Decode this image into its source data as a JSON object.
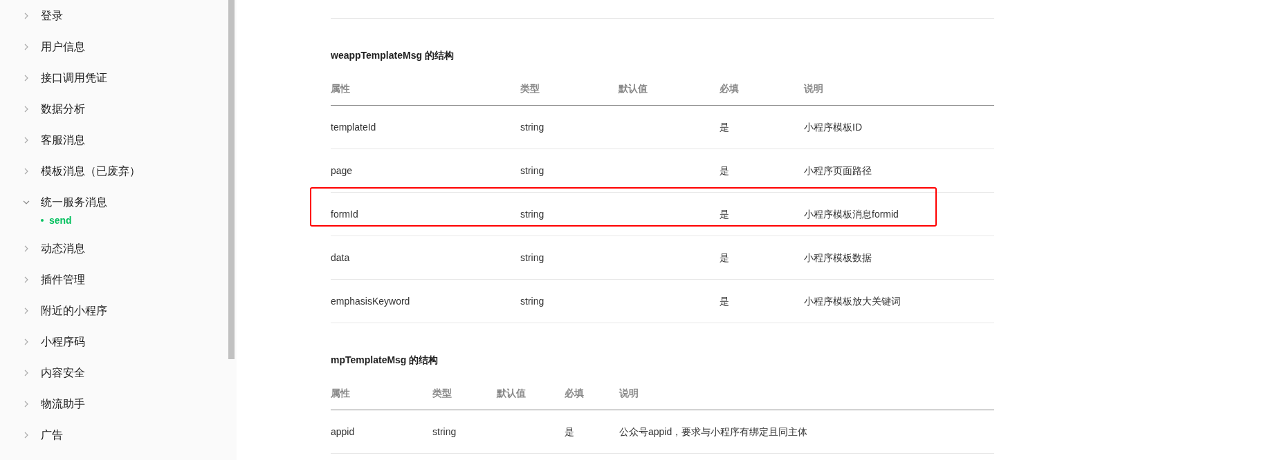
{
  "sidebar": {
    "items": [
      {
        "label": "登录",
        "expanded": false
      },
      {
        "label": "用户信息",
        "expanded": false
      },
      {
        "label": "接口调用凭证",
        "expanded": false
      },
      {
        "label": "数据分析",
        "expanded": false
      },
      {
        "label": "客服消息",
        "expanded": false
      },
      {
        "label": "模板消息（已废弃）",
        "expanded": false
      },
      {
        "label": "统一服务消息",
        "expanded": true,
        "children": [
          {
            "label": "send",
            "selected": true
          }
        ]
      },
      {
        "label": "动态消息",
        "expanded": false
      },
      {
        "label": "插件管理",
        "expanded": false
      },
      {
        "label": "附近的小程序",
        "expanded": false
      },
      {
        "label": "小程序码",
        "expanded": false
      },
      {
        "label": "内容安全",
        "expanded": false
      },
      {
        "label": "物流助手",
        "expanded": false
      },
      {
        "label": "广告",
        "expanded": false
      }
    ]
  },
  "sections": [
    {
      "title": "weappTemplateMsg 的结构",
      "columns": [
        "属性",
        "类型",
        "默认值",
        "必填",
        "说明"
      ],
      "rows": [
        {
          "cells": [
            "templateId",
            "string",
            "",
            "是",
            "小程序模板ID"
          ],
          "highlighted": false
        },
        {
          "cells": [
            "page",
            "string",
            "",
            "是",
            "小程序页面路径"
          ],
          "highlighted": false
        },
        {
          "cells": [
            "formId",
            "string",
            "",
            "是",
            "小程序模板消息formid"
          ],
          "highlighted": true
        },
        {
          "cells": [
            "data",
            "string",
            "",
            "是",
            "小程序模板数据"
          ],
          "highlighted": false
        },
        {
          "cells": [
            "emphasisKeyword",
            "string",
            "",
            "是",
            "小程序模板放大关键词"
          ],
          "highlighted": false
        }
      ]
    },
    {
      "title": "mpTemplateMsg 的结构",
      "columns": [
        "属性",
        "类型",
        "默认值",
        "必填",
        "说明"
      ],
      "rows": [
        {
          "cells": [
            "appid",
            "string",
            "",
            "是",
            "公众号appid，要求与小程序有绑定且同主体"
          ],
          "highlighted": false
        }
      ]
    }
  ]
}
